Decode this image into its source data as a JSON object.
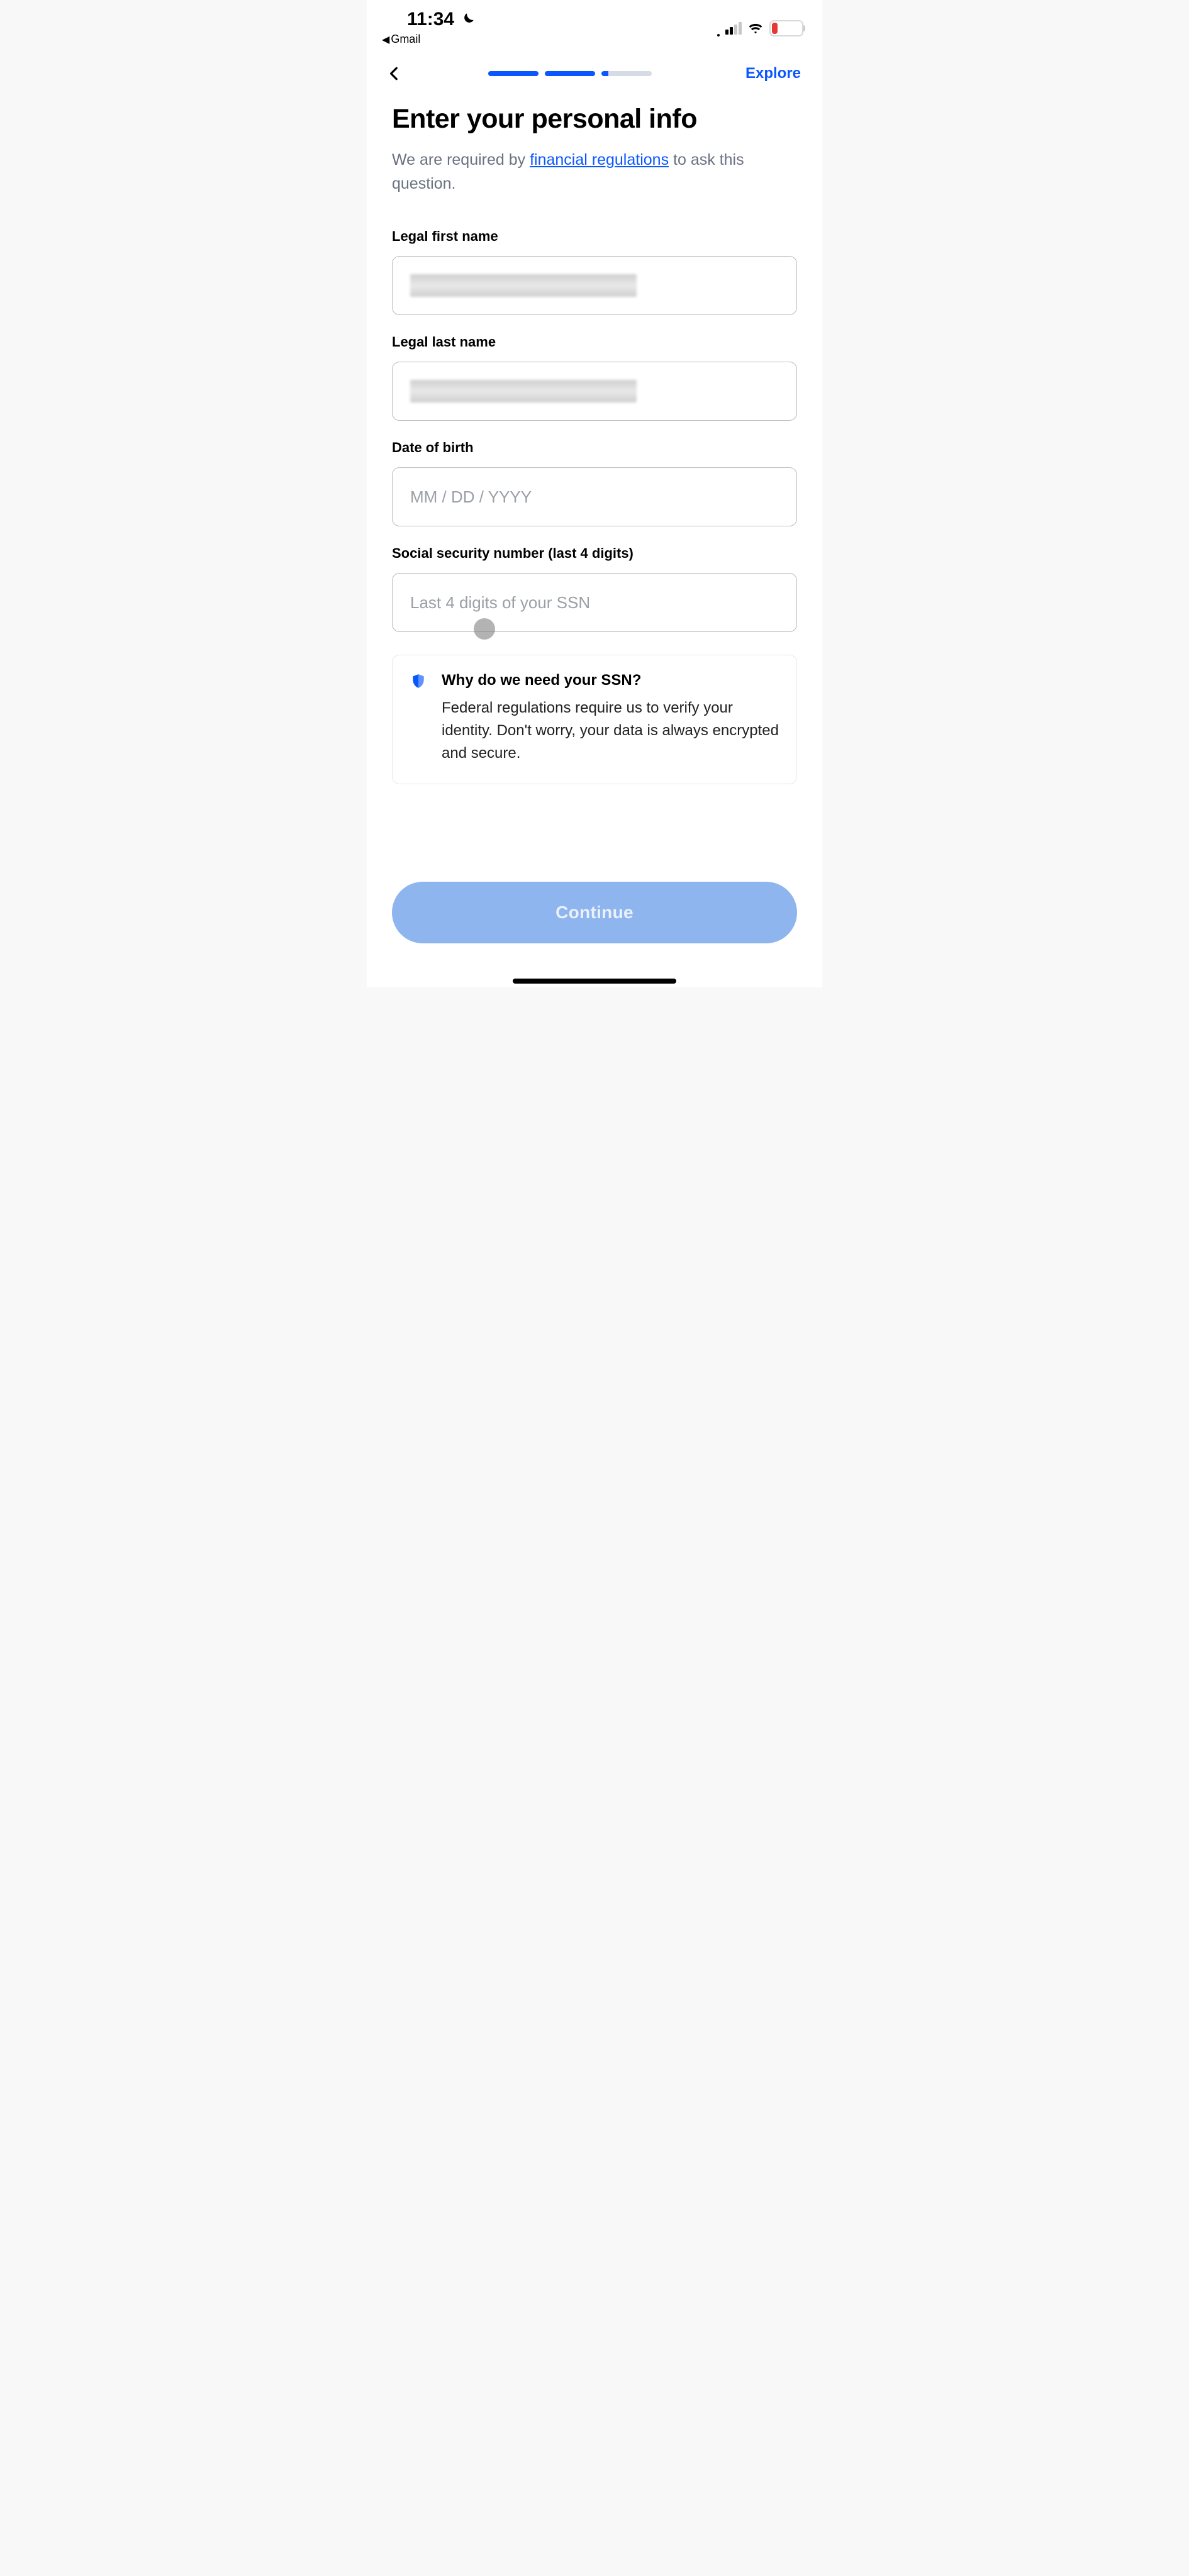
{
  "status": {
    "time": "11:34",
    "back_app_label": "Gmail",
    "battery_percent": "17"
  },
  "nav": {
    "explore_label": "Explore"
  },
  "header": {
    "title": "Enter your personal info",
    "subtitle_pre": "We are required by ",
    "subtitle_link": "financial regulations",
    "subtitle_post": " to ask this question."
  },
  "fields": {
    "first_name": {
      "label": "Legal first name",
      "value": ""
    },
    "last_name": {
      "label": "Legal last name",
      "value": ""
    },
    "dob": {
      "label": "Date of birth",
      "placeholder": "MM / DD / YYYY",
      "value": ""
    },
    "ssn": {
      "label": "Social security number (last 4 digits)",
      "placeholder": "Last 4 digits of your SSN",
      "value": ""
    }
  },
  "info_card": {
    "title": "Why do we need your SSN?",
    "body": "Federal regulations require us to verify your identity. Don't worry, your data is always encrypted and secure."
  },
  "cta": {
    "continue_label": "Continue"
  }
}
